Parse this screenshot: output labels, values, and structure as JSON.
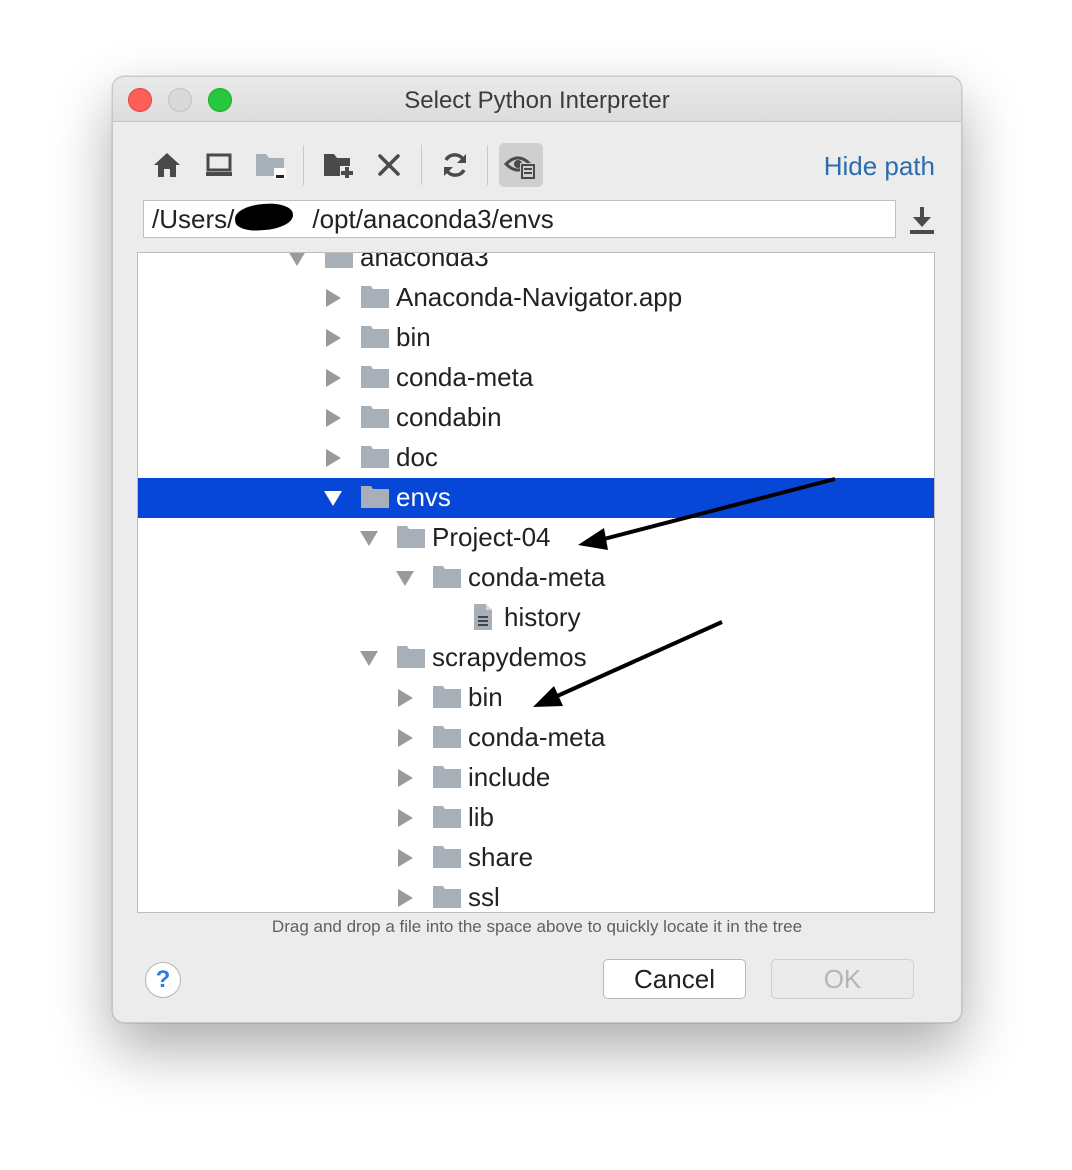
{
  "window": {
    "title": "Select Python Interpreter"
  },
  "toolbar": {
    "icons": [
      "home-icon",
      "desktop-icon",
      "project-folder-icon",
      "new-folder-icon",
      "delete-icon",
      "refresh-icon",
      "show-hidden-icon"
    ],
    "hide_path_label": "Hide path"
  },
  "path": {
    "value": "/Users/   /opt/anaconda3/envs"
  },
  "tree": {
    "rows": [
      {
        "label": "anaconda3",
        "expanded": true,
        "type": "folder"
      },
      {
        "label": "Anaconda-Navigator.app",
        "expanded": false,
        "type": "folder"
      },
      {
        "label": "bin",
        "expanded": false,
        "type": "folder"
      },
      {
        "label": "conda-meta",
        "expanded": false,
        "type": "folder"
      },
      {
        "label": "condabin",
        "expanded": false,
        "type": "folder"
      },
      {
        "label": "doc",
        "expanded": false,
        "type": "folder"
      },
      {
        "label": "envs",
        "expanded": true,
        "type": "folder",
        "selected": true
      },
      {
        "label": "Project-04",
        "expanded": true,
        "type": "folder"
      },
      {
        "label": "conda-meta",
        "expanded": true,
        "type": "folder"
      },
      {
        "label": "history",
        "type": "file"
      },
      {
        "label": "scrapydemos",
        "expanded": true,
        "type": "folder"
      },
      {
        "label": "bin",
        "expanded": false,
        "type": "folder"
      },
      {
        "label": "conda-meta",
        "expanded": false,
        "type": "folder"
      },
      {
        "label": "include",
        "expanded": false,
        "type": "folder"
      },
      {
        "label": "lib",
        "expanded": false,
        "type": "folder"
      },
      {
        "label": "share",
        "expanded": false,
        "type": "folder"
      },
      {
        "label": "ssl",
        "expanded": false,
        "type": "folder"
      }
    ]
  },
  "hint": "Drag and drop a file into the space above to quickly locate it in the tree",
  "buttons": {
    "help": "?",
    "cancel": "Cancel",
    "ok": "OK"
  },
  "colors": {
    "selection": "#0747d7",
    "link": "#2c6bb0",
    "folder": "#a7b0b8",
    "arrow": "#9a9a9a"
  }
}
